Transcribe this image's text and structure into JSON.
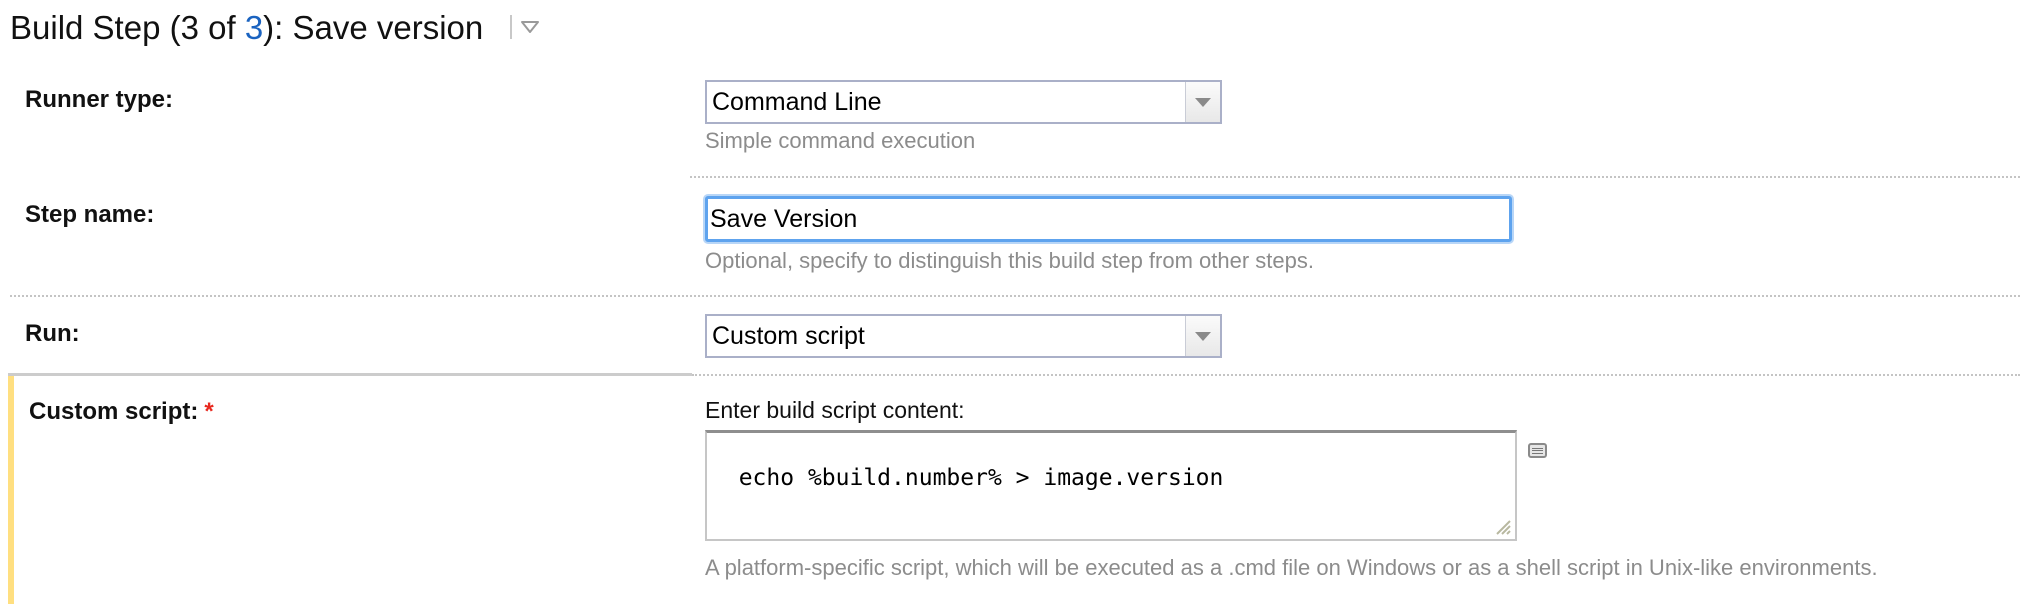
{
  "header": {
    "title_prefix": "Build Step (3 of ",
    "title_link": "3",
    "title_suffix": "): Save version",
    "menu_icon": "triangle-down-icon"
  },
  "colors": {
    "link": "#1a63c0",
    "required": "#e8281e",
    "focus": "#5ea3ee",
    "highlight_bar": "#ffdf80",
    "hint_text": "#8c8c8c"
  },
  "fields": {
    "runner_type": {
      "label": "Runner type:",
      "value": "Command Line",
      "hint": "Simple command execution"
    },
    "step_name": {
      "label": "Step name:",
      "value": "Save Version",
      "hint": "Optional, specify to distinguish this build step from other steps."
    },
    "run": {
      "label": "Run:",
      "value": "Custom script"
    },
    "custom_script": {
      "label": "Custom script:",
      "required_marker": "*",
      "content_label": "Enter build script content:",
      "value": "echo %build.number% > image.version",
      "hint": "A platform-specific script, which will be executed as a .cmd file on Windows or as a shell script in Unix-like environments.",
      "editor_icon": "text-editor-icon"
    }
  }
}
